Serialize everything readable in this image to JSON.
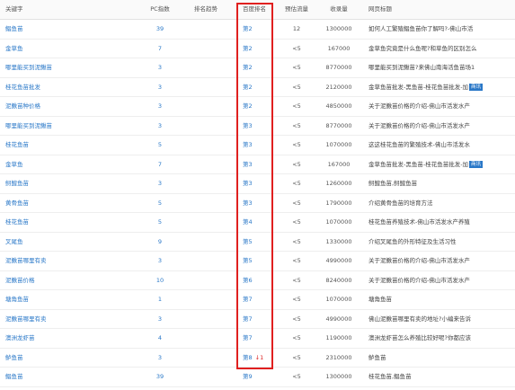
{
  "header": {
    "keyword": "关键字",
    "pc_index": "PC指数",
    "trend": "排名趋势",
    "baidu_rank": "百度排名",
    "est_flow": "预估流量",
    "indexed": "收录量",
    "page_title": "网页标题"
  },
  "rows": [
    {
      "keyword": "鲳鱼苗",
      "pc": "39",
      "rank": "第2",
      "flow": "12",
      "count": "1300000",
      "title": "如何人工繁殖鲳鱼苗你了解吗?-佛山市活"
    },
    {
      "keyword": "金草鱼",
      "pc": "7",
      "rank": "第2",
      "flow": "<5",
      "count": "167000",
      "title": "金草鱼究竟是什么鱼呢?和草鱼的区别怎么"
    },
    {
      "keyword": "哪里能买到泥鳅苗",
      "pc": "3",
      "rank": "第2",
      "flow": "<5",
      "count": "8770000",
      "title": "哪里能买到泥鳅苗?来佛山南海活鱼苗场1"
    },
    {
      "keyword": "桂花鱼苗批发",
      "pc": "3",
      "rank": "第2",
      "flow": "<5",
      "count": "2120000",
      "title": "金草鱼苗批发-黑鱼苗-桂花鱼苗批发-加",
      "ad": "商讯"
    },
    {
      "keyword": "泥鳅苗种价格",
      "pc": "3",
      "rank": "第2",
      "flow": "<5",
      "count": "4850000",
      "title": "关于泥鳅苗价格的介绍-佛山市活发水产"
    },
    {
      "keyword": "哪里能买到泥鳅苗",
      "pc": "3",
      "rank": "第3",
      "flow": "<5",
      "count": "8770000",
      "title": "关于泥鳅苗价格的介绍-佛山市活发水产"
    },
    {
      "keyword": "桂花鱼苗",
      "pc": "5",
      "rank": "第3",
      "flow": "<5",
      "count": "1070000",
      "title": "这这桂花鱼苗的繁殖技术-佛山市活发水"
    },
    {
      "keyword": "金草鱼",
      "pc": "7",
      "rank": "第3",
      "flow": "<5",
      "count": "167000",
      "title": "金草鱼苗批发-黑鱼苗-桂花鱼苗批发-加",
      "ad": "商讯"
    },
    {
      "keyword": "鲟鳇鱼苗",
      "pc": "3",
      "rank": "第3",
      "flow": "<5",
      "count": "1260000",
      "title": "鲟鳇鱼苗,鲟鳇鱼苗"
    },
    {
      "keyword": "黄骨鱼苗",
      "pc": "5",
      "rank": "第3",
      "flow": "<5",
      "count": "1790000",
      "title": "介绍黄骨鱼苗的培育方法"
    },
    {
      "keyword": "桂花鱼苗",
      "pc": "5",
      "rank": "第4",
      "flow": "<5",
      "count": "1070000",
      "title": "桂花鱼苗养殖技术-佛山市活发水产养殖"
    },
    {
      "keyword": "叉尾鱼",
      "pc": "9",
      "rank": "第5",
      "flow": "<5",
      "count": "1330000",
      "title": "介绍叉尾鱼的外形特征及生活习性"
    },
    {
      "keyword": "泥鳅苗哪里有卖",
      "pc": "3",
      "rank": "第5",
      "flow": "<5",
      "count": "4990000",
      "title": "关于泥鳅苗价格的介绍-佛山市活发水产"
    },
    {
      "keyword": "泥鳅苗价格",
      "pc": "10",
      "rank": "第6",
      "flow": "<5",
      "count": "8240000",
      "title": "关于泥鳅苗价格的介绍-佛山市活发水产"
    },
    {
      "keyword": "塘角鱼苗",
      "pc": "1",
      "rank": "第7",
      "flow": "<5",
      "count": "1070000",
      "title": "塘角鱼苗"
    },
    {
      "keyword": "泥鳅苗哪里有卖",
      "pc": "3",
      "rank": "第7",
      "flow": "<5",
      "count": "4990000",
      "title": "佛山泥鳅苗哪里有卖的地址?小编来告诉"
    },
    {
      "keyword": "澳洲龙虾苗",
      "pc": "4",
      "rank": "第7",
      "flow": "<5",
      "count": "1190000",
      "title": "澳洲龙虾苗怎么养殖比较好呢?你都应该"
    },
    {
      "keyword": "鲈鱼苗",
      "pc": "3",
      "rank": "第8",
      "arrow": "↓1",
      "flow": "<5",
      "count": "2310000",
      "title": "鲈鱼苗"
    },
    {
      "keyword": "鲳鱼苗",
      "pc": "39",
      "rank": "第9",
      "flow": "<5",
      "count": "1300000",
      "title": "桂花鱼苗,鲳鱼苗"
    }
  ],
  "trends": [
    [
      0,
      0.05,
      0.15,
      0.55,
      0.85,
      0.9
    ],
    [
      0,
      0.3,
      0.6,
      0.6,
      0.55,
      0.6
    ],
    [
      0,
      0.05,
      0.1,
      0.15,
      0.25,
      0.7
    ],
    [
      0,
      0.02,
      0.05,
      0.3,
      0.85,
      0.9
    ],
    [
      0,
      0.02,
      0.05,
      0.1,
      0.3,
      0.9
    ],
    [
      0,
      0.02,
      0.05,
      0.1,
      0.2,
      0.9
    ],
    [
      0.85,
      0.7,
      0.6,
      0.55,
      0.5,
      0.5
    ],
    [
      0,
      0.02,
      0.3,
      0.85,
      0.9,
      0.9
    ],
    [
      0,
      0.02,
      0.05,
      0.1,
      0.3,
      0.9
    ],
    [
      0,
      0.02,
      0.05,
      0.1,
      0.5,
      0.9
    ],
    [
      0,
      0.02,
      0.05,
      0.1,
      0.6,
      0.9
    ],
    [
      0,
      0.02,
      0.05,
      0.1,
      0.2,
      0.9
    ],
    [
      0,
      0.02,
      0.05,
      0.1,
      0.2,
      0.9
    ],
    [
      0,
      0.02,
      0.05,
      0.1,
      0.2,
      0.9
    ],
    [
      0,
      0.02,
      0.05,
      0.1,
      0.2,
      0.9
    ],
    [
      0,
      0.02,
      0.05,
      0.1,
      0.5,
      0.9
    ],
    [
      0,
      0.02,
      0.05,
      0.1,
      0.6,
      0.9
    ],
    [
      0,
      0.02,
      0.05,
      0.1,
      0.6,
      0.9
    ],
    [
      0,
      0.02,
      0.05,
      0.1,
      0.6,
      0.9
    ]
  ],
  "colors": {
    "link": "#2a78c8",
    "highlight_border": "#e0201f",
    "spark_line": "#8aa3c8",
    "spark_fill": "#e6ecf6",
    "arrow": "#d22222"
  }
}
